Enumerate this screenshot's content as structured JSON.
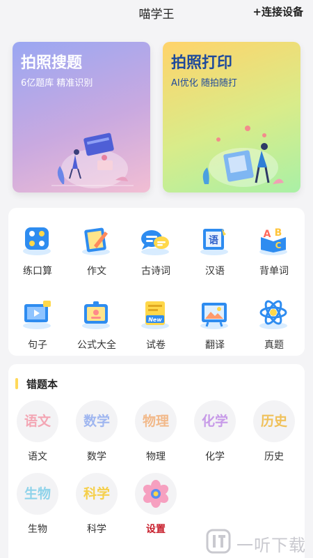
{
  "header": {
    "title": "喵学王",
    "connect_label": "+连接设备"
  },
  "cards": [
    {
      "title": "拍照搜题",
      "subtitle": "6亿题库 精准识别"
    },
    {
      "title": "拍照打印",
      "subtitle": "AI优化 随拍随打"
    }
  ],
  "tools": [
    {
      "label": "练口算",
      "icon": "calculator-icon"
    },
    {
      "label": "作文",
      "icon": "pencil-notebook-icon"
    },
    {
      "label": "古诗词",
      "icon": "speech-bubble-icon"
    },
    {
      "label": "汉语",
      "icon": "chinese-book-icon"
    },
    {
      "label": "背单词",
      "icon": "abc-book-icon"
    },
    {
      "label": "句子",
      "icon": "video-screen-icon"
    },
    {
      "label": "公式大全",
      "icon": "id-card-icon"
    },
    {
      "label": "试卷",
      "icon": "new-paper-icon"
    },
    {
      "label": "翻译",
      "icon": "picture-board-icon"
    },
    {
      "label": "真题",
      "icon": "atom-icon"
    }
  ],
  "wrong_book": {
    "title": "错题本",
    "subjects": [
      {
        "glyph": "语文",
        "label": "语文",
        "color": "#f3a6b4"
      },
      {
        "glyph": "数学",
        "label": "数学",
        "color": "#9fb6f0"
      },
      {
        "glyph": "物理",
        "label": "物理",
        "color": "#f2b98a"
      },
      {
        "glyph": "化学",
        "label": "化学",
        "color": "#c79ae8"
      },
      {
        "glyph": "历史",
        "label": "历史",
        "color": "#f0c15a"
      },
      {
        "glyph": "生物",
        "label": "生物",
        "color": "#8fd3ea"
      },
      {
        "glyph": "科学",
        "label": "科学",
        "color": "#f5cf4a"
      },
      {
        "glyph": "",
        "label": "设置",
        "color": "#f08da8"
      }
    ]
  },
  "watermark": {
    "text": "一听下载"
  }
}
